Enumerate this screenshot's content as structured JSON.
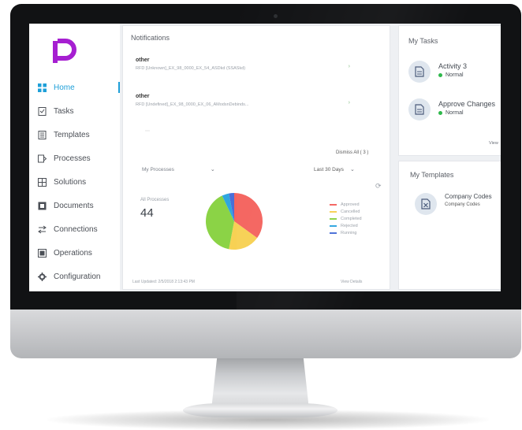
{
  "brand": {
    "accent": "#a61fd1",
    "active_color": "#1e9fd8"
  },
  "sidebar": {
    "items": [
      {
        "label": "Home",
        "icon": "home-grid-icon",
        "active": true
      },
      {
        "label": "Tasks",
        "icon": "tasks-icon"
      },
      {
        "label": "Templates",
        "icon": "templates-icon"
      },
      {
        "label": "Processes",
        "icon": "processes-icon"
      },
      {
        "label": "Solutions",
        "icon": "solutions-icon"
      },
      {
        "label": "Documents",
        "icon": "documents-icon"
      },
      {
        "label": "Connections",
        "icon": "connections-icon"
      },
      {
        "label": "Operations",
        "icon": "operations-icon"
      },
      {
        "label": "Configuration",
        "icon": "gear-icon"
      }
    ]
  },
  "notifications": {
    "title": "Notifications",
    "items": [
      {
        "title": "other",
        "desc": "RFD [Unknown]_EX_98_0000_EX_54_ASDkd (SSASkd)"
      },
      {
        "title": "other",
        "desc": "RFD [Undefined]_EX_98_0000_EX_06_AModsnDebinds..."
      }
    ],
    "dismiss_label": "Dismiss All ( 3 )",
    "filter_processes": "My Processes",
    "filter_period": "Last 30 Days",
    "total_label": "All Processes",
    "total_value": "44",
    "legend": [
      {
        "label": "Approved",
        "color": "#f4645f"
      },
      {
        "label": "Cancelled",
        "color": "#f7d154"
      },
      {
        "label": "Completed",
        "color": "#8bd346"
      },
      {
        "label": "Rejected",
        "color": "#2fa6e0"
      },
      {
        "label": "Running",
        "color": "#4a6fd8"
      }
    ],
    "last_updated": "Last Updated: 2/5/2018 2:13:43 PM",
    "footer_link": "View Details"
  },
  "chart_data": {
    "type": "pie",
    "categories": [
      "Approved",
      "Cancelled",
      "Completed",
      "Rejected",
      "Running"
    ],
    "values": [
      35,
      18,
      40,
      4,
      3
    ],
    "colors": [
      "#f4645f",
      "#f7d154",
      "#8bd346",
      "#2fa6e0",
      "#4a6fd8"
    ],
    "legend_position": "right"
  },
  "my_tasks": {
    "title": "My Tasks",
    "items": [
      {
        "title": "Activity 3",
        "status": "Normal"
      },
      {
        "title": "Approve Changes",
        "status": "Normal"
      }
    ],
    "view_link": "View"
  },
  "my_templates": {
    "title": "My Templates",
    "items": [
      {
        "title": "Company Codes",
        "subtitle": "Company Codes"
      }
    ]
  }
}
